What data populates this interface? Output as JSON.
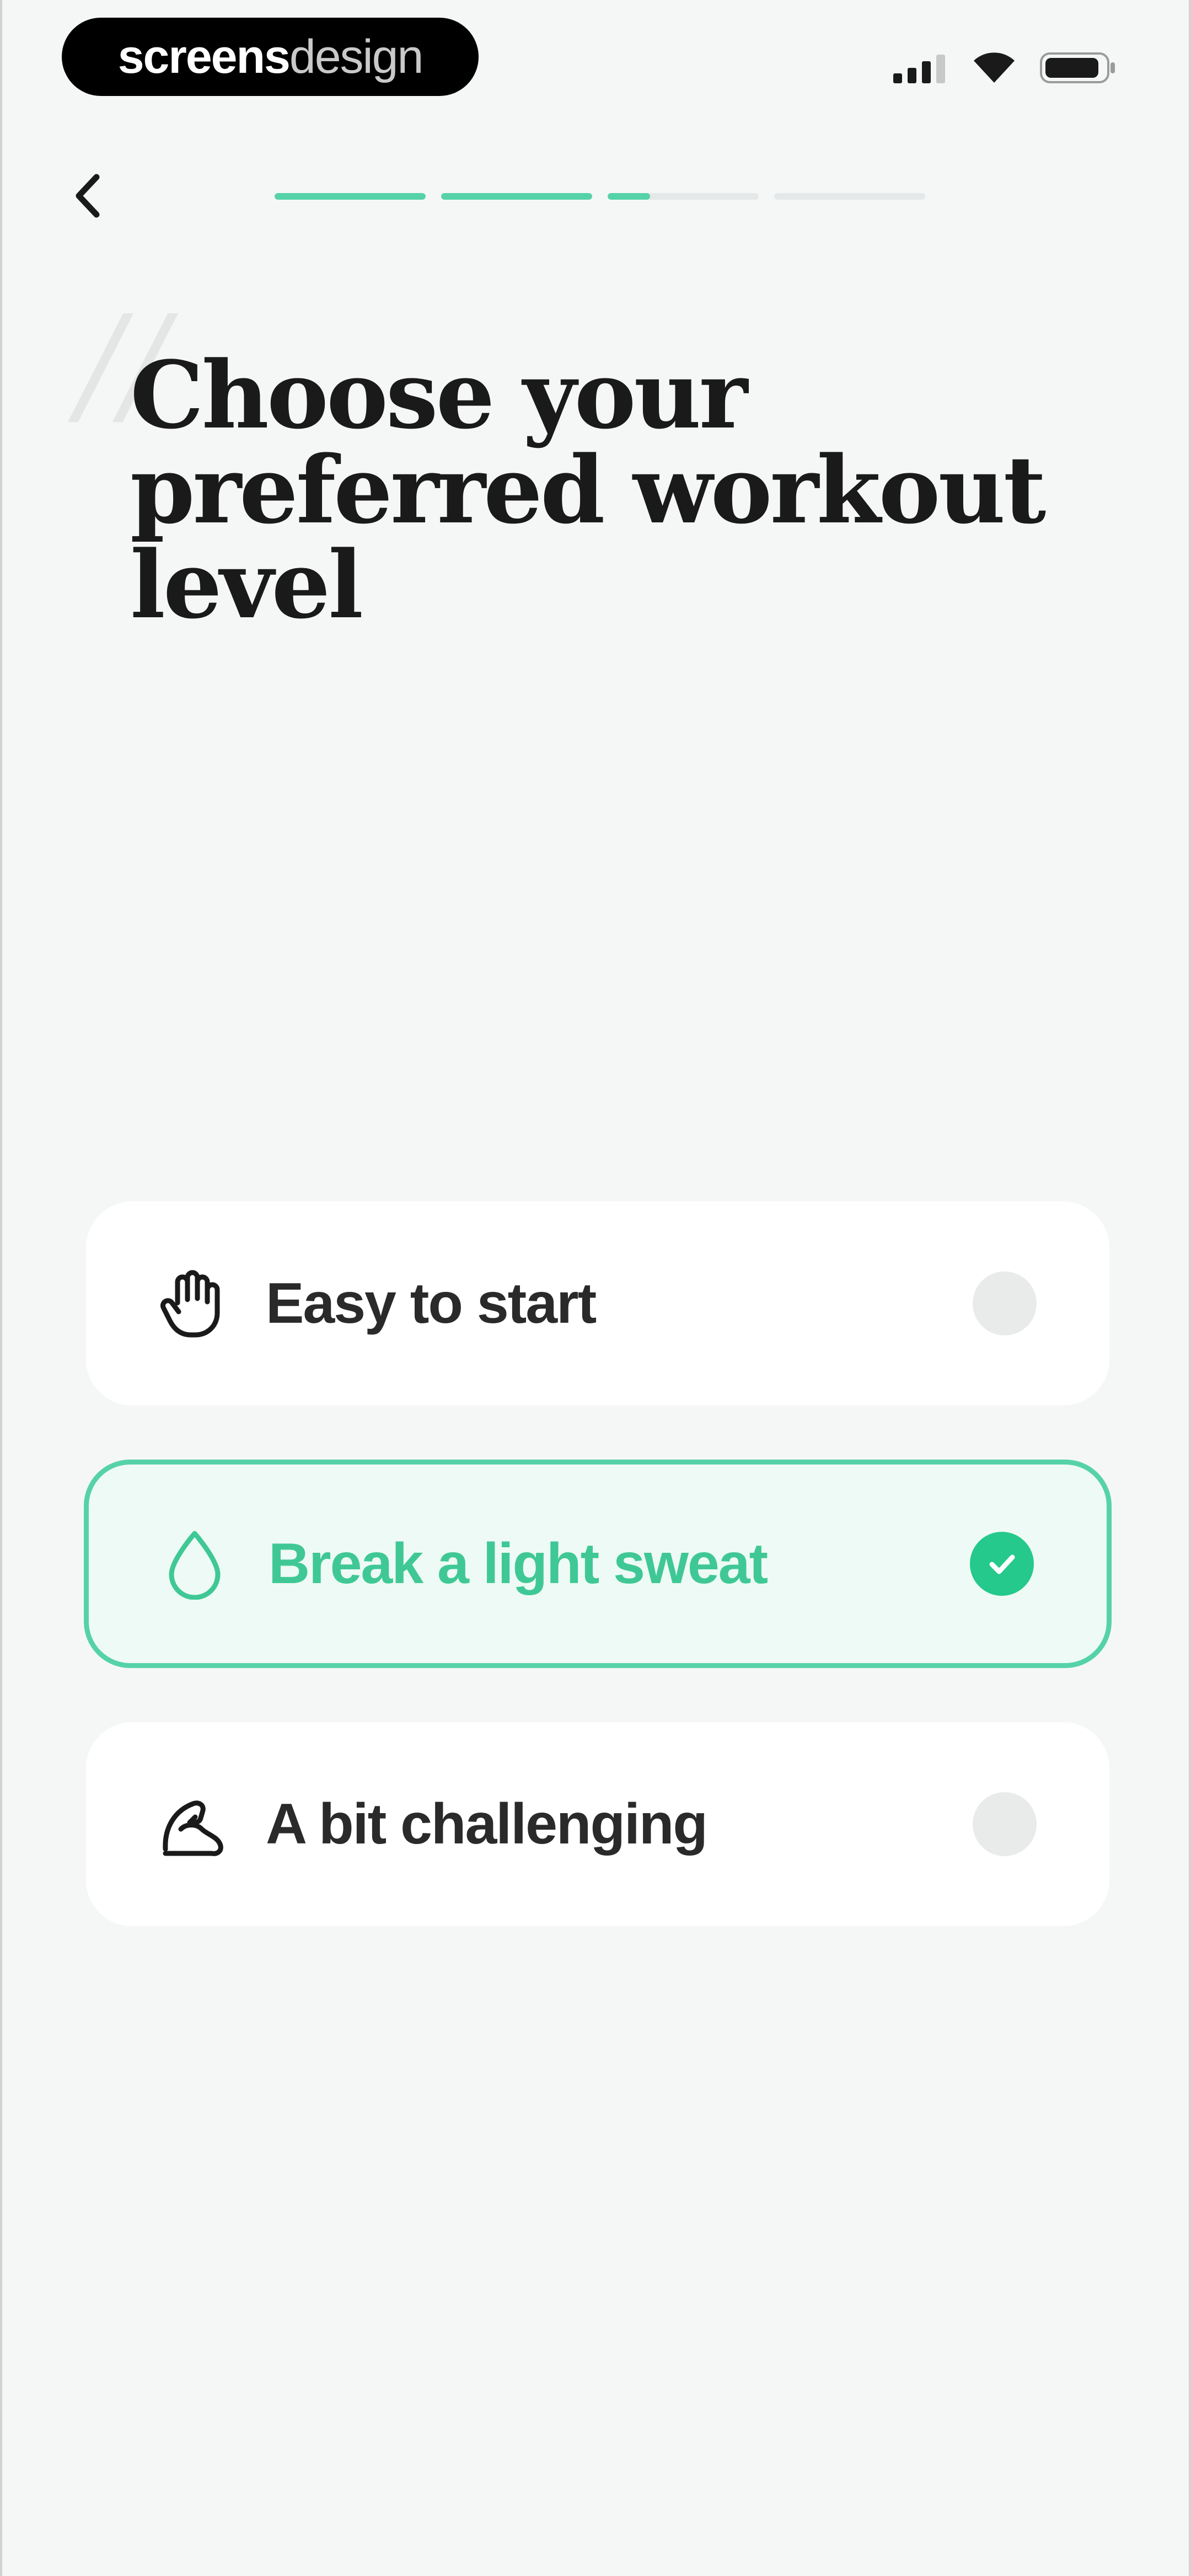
{
  "watermark": {
    "part_a": "screens",
    "part_b": "design"
  },
  "status_bar": {
    "icons": [
      "signal-icon",
      "wifi-icon",
      "battery-icon"
    ]
  },
  "header": {
    "back_icon": "chevron-left-icon",
    "progress": [
      1,
      1,
      0.28,
      0
    ]
  },
  "title": "Choose your preferred workout level",
  "options": [
    {
      "label": "Easy to start",
      "icon": "hand-icon",
      "selected": false
    },
    {
      "label": "Break a light sweat",
      "icon": "droplet-icon",
      "selected": true
    },
    {
      "label": "A bit challenging",
      "icon": "flexed-arm-icon",
      "selected": false
    }
  ],
  "colors": {
    "accent": "#56d2a8",
    "accent_strong": "#24c98b",
    "selected_bg": "#eefaf5",
    "background": "#f5f7f7",
    "text": "#1a1a1a"
  }
}
